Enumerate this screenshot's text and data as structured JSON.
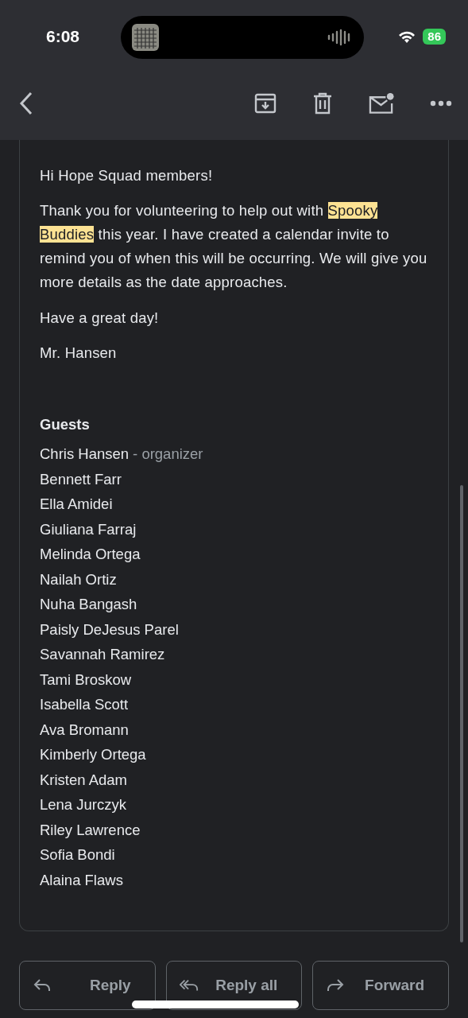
{
  "status_bar": {
    "time": "6:08",
    "battery": "86"
  },
  "toolbar": {
    "actions": [
      {
        "kind": "archive"
      },
      {
        "kind": "delete"
      },
      {
        "kind": "unread"
      },
      {
        "kind": "more"
      }
    ]
  },
  "message": {
    "greeting": "Hi Hope Squad members!",
    "body": {
      "before": "Thank you for volunteering to help out with ",
      "highlight": "Spooky Buddies",
      "after": " this year. I have created a calendar invite to remind you of when this will be occurring. We will give you more details as the date approaches."
    },
    "closing": "Have a great day!",
    "signature": "Mr. Hansen",
    "guests_title": "Guests",
    "guests": [
      {
        "name": "Chris Hansen",
        "role": "- organizer"
      },
      {
        "name": "Bennett Farr"
      },
      {
        "name": "Ella Amidei"
      },
      {
        "name": "Giuliana Farraj"
      },
      {
        "name": "Melinda Ortega"
      },
      {
        "name": "Nailah Ortiz"
      },
      {
        "name": "Nuha Bangash"
      },
      {
        "name": "Paisly DeJesus Parel"
      },
      {
        "name": "Savannah Ramirez"
      },
      {
        "name": "Tami Broskow"
      },
      {
        "name": "Isabella Scott"
      },
      {
        "name": "Ava Bromann"
      },
      {
        "name": "Kimberly Ortega"
      },
      {
        "name": "Kristen Adam"
      },
      {
        "name": "Lena Jurczyk"
      },
      {
        "name": "Riley Lawrence"
      },
      {
        "name": "Sofia Bondi"
      },
      {
        "name": "Alaina Flaws"
      }
    ]
  },
  "reply_buttons": [
    {
      "kind": "reply",
      "label": "Reply"
    },
    {
      "kind": "reply_all",
      "label": "Reply all"
    },
    {
      "kind": "forward",
      "label": "Forward"
    }
  ]
}
